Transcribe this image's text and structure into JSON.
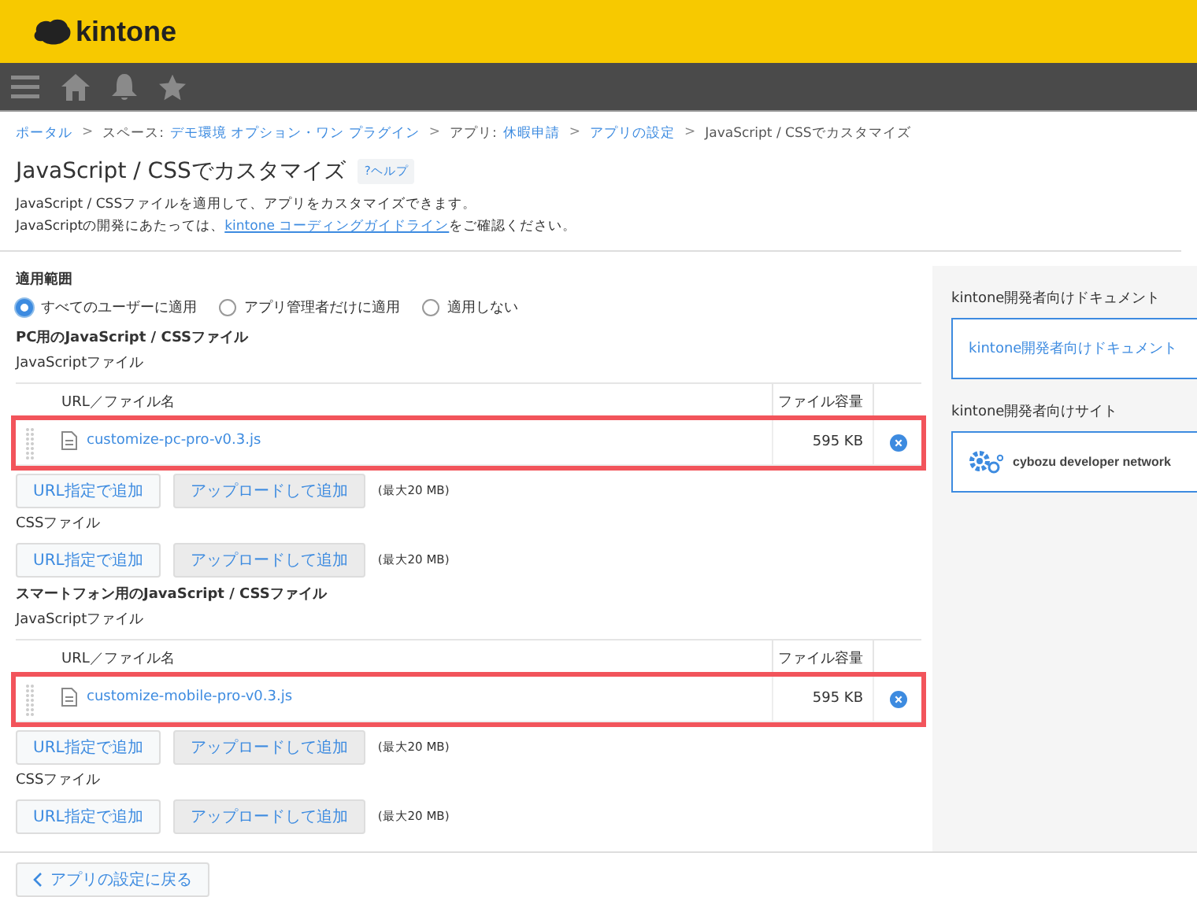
{
  "header": {
    "logo": "kintone"
  },
  "breadcrumb": {
    "separator": ">",
    "items": [
      {
        "label": "ポータル",
        "link": true
      },
      {
        "prefix": "スペース: ",
        "label": "デモ環境 オプション・ワン プラグイン",
        "link": true
      },
      {
        "prefix": "アプリ: ",
        "label": "休暇申請",
        "link": true
      },
      {
        "label": "アプリの設定",
        "link": true
      },
      {
        "label": "JavaScript / CSSでカスタマイズ",
        "link": false
      }
    ]
  },
  "title": "JavaScript / CSSでカスタマイズ",
  "help": "?ヘルプ",
  "description": [
    {
      "text": "JavaScript / CSSファイルを適用して、アプリをカスタマイズできます。"
    },
    {
      "text": "JavaScriptの開発にあたっては、",
      "link": "kintone コーディングガイドライン",
      "after": "をご確認ください。"
    }
  ],
  "scope": {
    "label": "適用範囲",
    "options": [
      {
        "label": "すべてのユーザーに適用",
        "selected": true
      },
      {
        "label": "アプリ管理者だけに適用",
        "selected": false
      },
      {
        "label": "適用しない",
        "selected": false
      }
    ]
  },
  "sections": [
    {
      "heading": "PC用のJavaScript / CSSファイル",
      "groups": [
        {
          "label": "JavaScriptファイル",
          "columns": [
            "URL／ファイル名",
            "ファイル容量"
          ],
          "rows": [
            {
              "name": "customize-pc-pro-v0.3.js",
              "size": "595 KB",
              "highlighted": true
            }
          ],
          "buttons": [
            "URL指定で追加",
            "アップロードして追加"
          ],
          "note": "(最大20 MB)"
        },
        {
          "label": "CSSファイル",
          "buttons": [
            "URL指定で追加",
            "アップロードして追加"
          ],
          "note": "(最大20 MB)"
        }
      ]
    },
    {
      "heading": "スマートフォン用のJavaScript / CSSファイル",
      "groups": [
        {
          "label": "JavaScriptファイル",
          "columns": [
            "URL／ファイル名",
            "ファイル容量"
          ],
          "rows": [
            {
              "name": "customize-mobile-pro-v0.3.js",
              "size": "595 KB",
              "highlighted": true
            }
          ],
          "buttons": [
            "URL指定で追加",
            "アップロードして追加"
          ],
          "note": "(最大20 MB)"
        },
        {
          "label": "CSSファイル",
          "buttons": [
            "URL指定で追加",
            "アップロードして追加"
          ],
          "note": "(最大20 MB)"
        }
      ]
    }
  ],
  "sidebar": [
    {
      "heading": "kintone開発者向けドキュメント",
      "link": {
        "kind": "text",
        "label": "kintone開発者向けドキュメント"
      }
    },
    {
      "heading": "kintone開発者向けサイト",
      "link": {
        "kind": "logo",
        "label": "cybozu developer network"
      }
    }
  ],
  "footer": {
    "back": "アプリの設定に戻る"
  }
}
